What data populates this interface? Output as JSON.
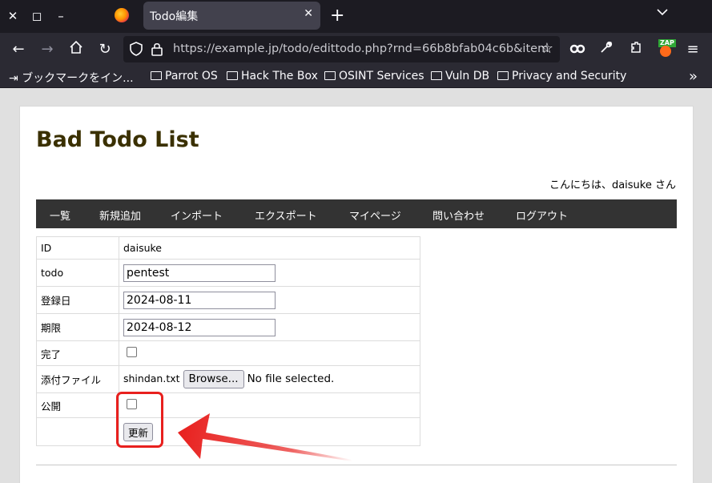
{
  "browser": {
    "tab_title": "Todo編集",
    "url": "https://example.jp/todo/edittodo.php?rnd=66b8bfab04c6b&item",
    "zap_badge": "ZAP",
    "bookmarks": [
      {
        "label": "ブックマークをイン..."
      },
      {
        "label": "Parrot OS"
      },
      {
        "label": "Hack The Box"
      },
      {
        "label": "OSINT Services"
      },
      {
        "label": "Vuln DB"
      },
      {
        "label": "Privacy and Security"
      }
    ]
  },
  "page": {
    "title": "Bad Todo List",
    "greeting": "こんにちは、daisuke さん",
    "menu": [
      "一覧",
      "新規追加",
      "インポート",
      "エクスポート",
      "マイページ",
      "問い合わせ",
      "ログアウト"
    ],
    "form": {
      "id_label": "ID",
      "id_value": "daisuke",
      "todo_label": "todo",
      "todo_value": "pentest",
      "reg_label": "登録日",
      "reg_value": "2024-08-11",
      "due_label": "期限",
      "due_value": "2024-08-12",
      "done_label": "完了",
      "done_checked": false,
      "attach_label": "添付ファイル",
      "attach_filename": "shindan.txt",
      "browse_label": "Browse...",
      "no_file_label": "No file selected.",
      "public_label": "公開",
      "public_checked": false,
      "submit_label": "更新"
    }
  },
  "annotation": {
    "color": "#e8201e"
  }
}
